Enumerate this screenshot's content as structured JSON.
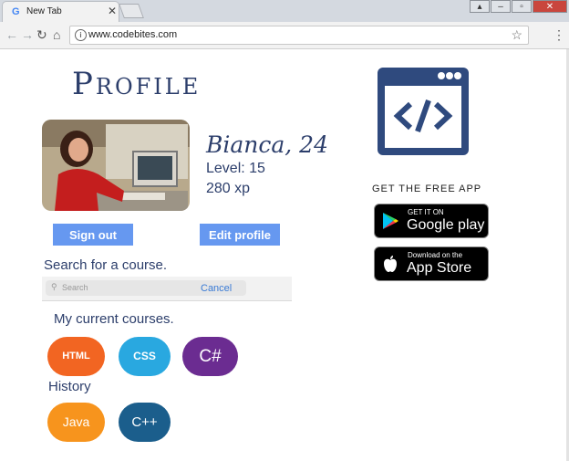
{
  "browser": {
    "tab_title": "New Tab",
    "tab_favicon": "G",
    "url": "www.codebites.com"
  },
  "profile": {
    "title": "Profile",
    "name": "Bianca, 24",
    "level": "Level: 15",
    "xp": "280 xp",
    "sign_out_label": "Sign out",
    "edit_profile_label": "Edit profile"
  },
  "search": {
    "heading": "Search for a course.",
    "placeholder": "Search",
    "cancel_label": "Cancel"
  },
  "courses": {
    "heading": "My current courses.",
    "current": [
      {
        "label": "HTML",
        "color": "#f26522"
      },
      {
        "label": "CSS",
        "color": "#29a8e0"
      },
      {
        "label": "C#",
        "color": "#6b2c91"
      }
    ],
    "history_heading": "History",
    "history": [
      {
        "label": "Java",
        "color": "#f7941d"
      },
      {
        "label": "C++",
        "color": "#1b5e8c"
      }
    ]
  },
  "app_promo": {
    "heading": "GET THE FREE APP",
    "google_play_small": "GET IT ON",
    "google_play_big": "Google play",
    "app_store_small": "Download on the",
    "app_store_big": "App Store"
  },
  "colors": {
    "brand_navy": "#2c3e6b",
    "button_blue": "#6698f0",
    "code_icon": "#2f4a7e"
  },
  "icons": [
    "back-arrow-icon",
    "forward-arrow-icon",
    "reload-icon",
    "home-icon",
    "info-icon",
    "star-icon",
    "menu-icon",
    "code-window-icon",
    "google-play-icon",
    "apple-icon",
    "search-icon",
    "close-icon"
  ]
}
